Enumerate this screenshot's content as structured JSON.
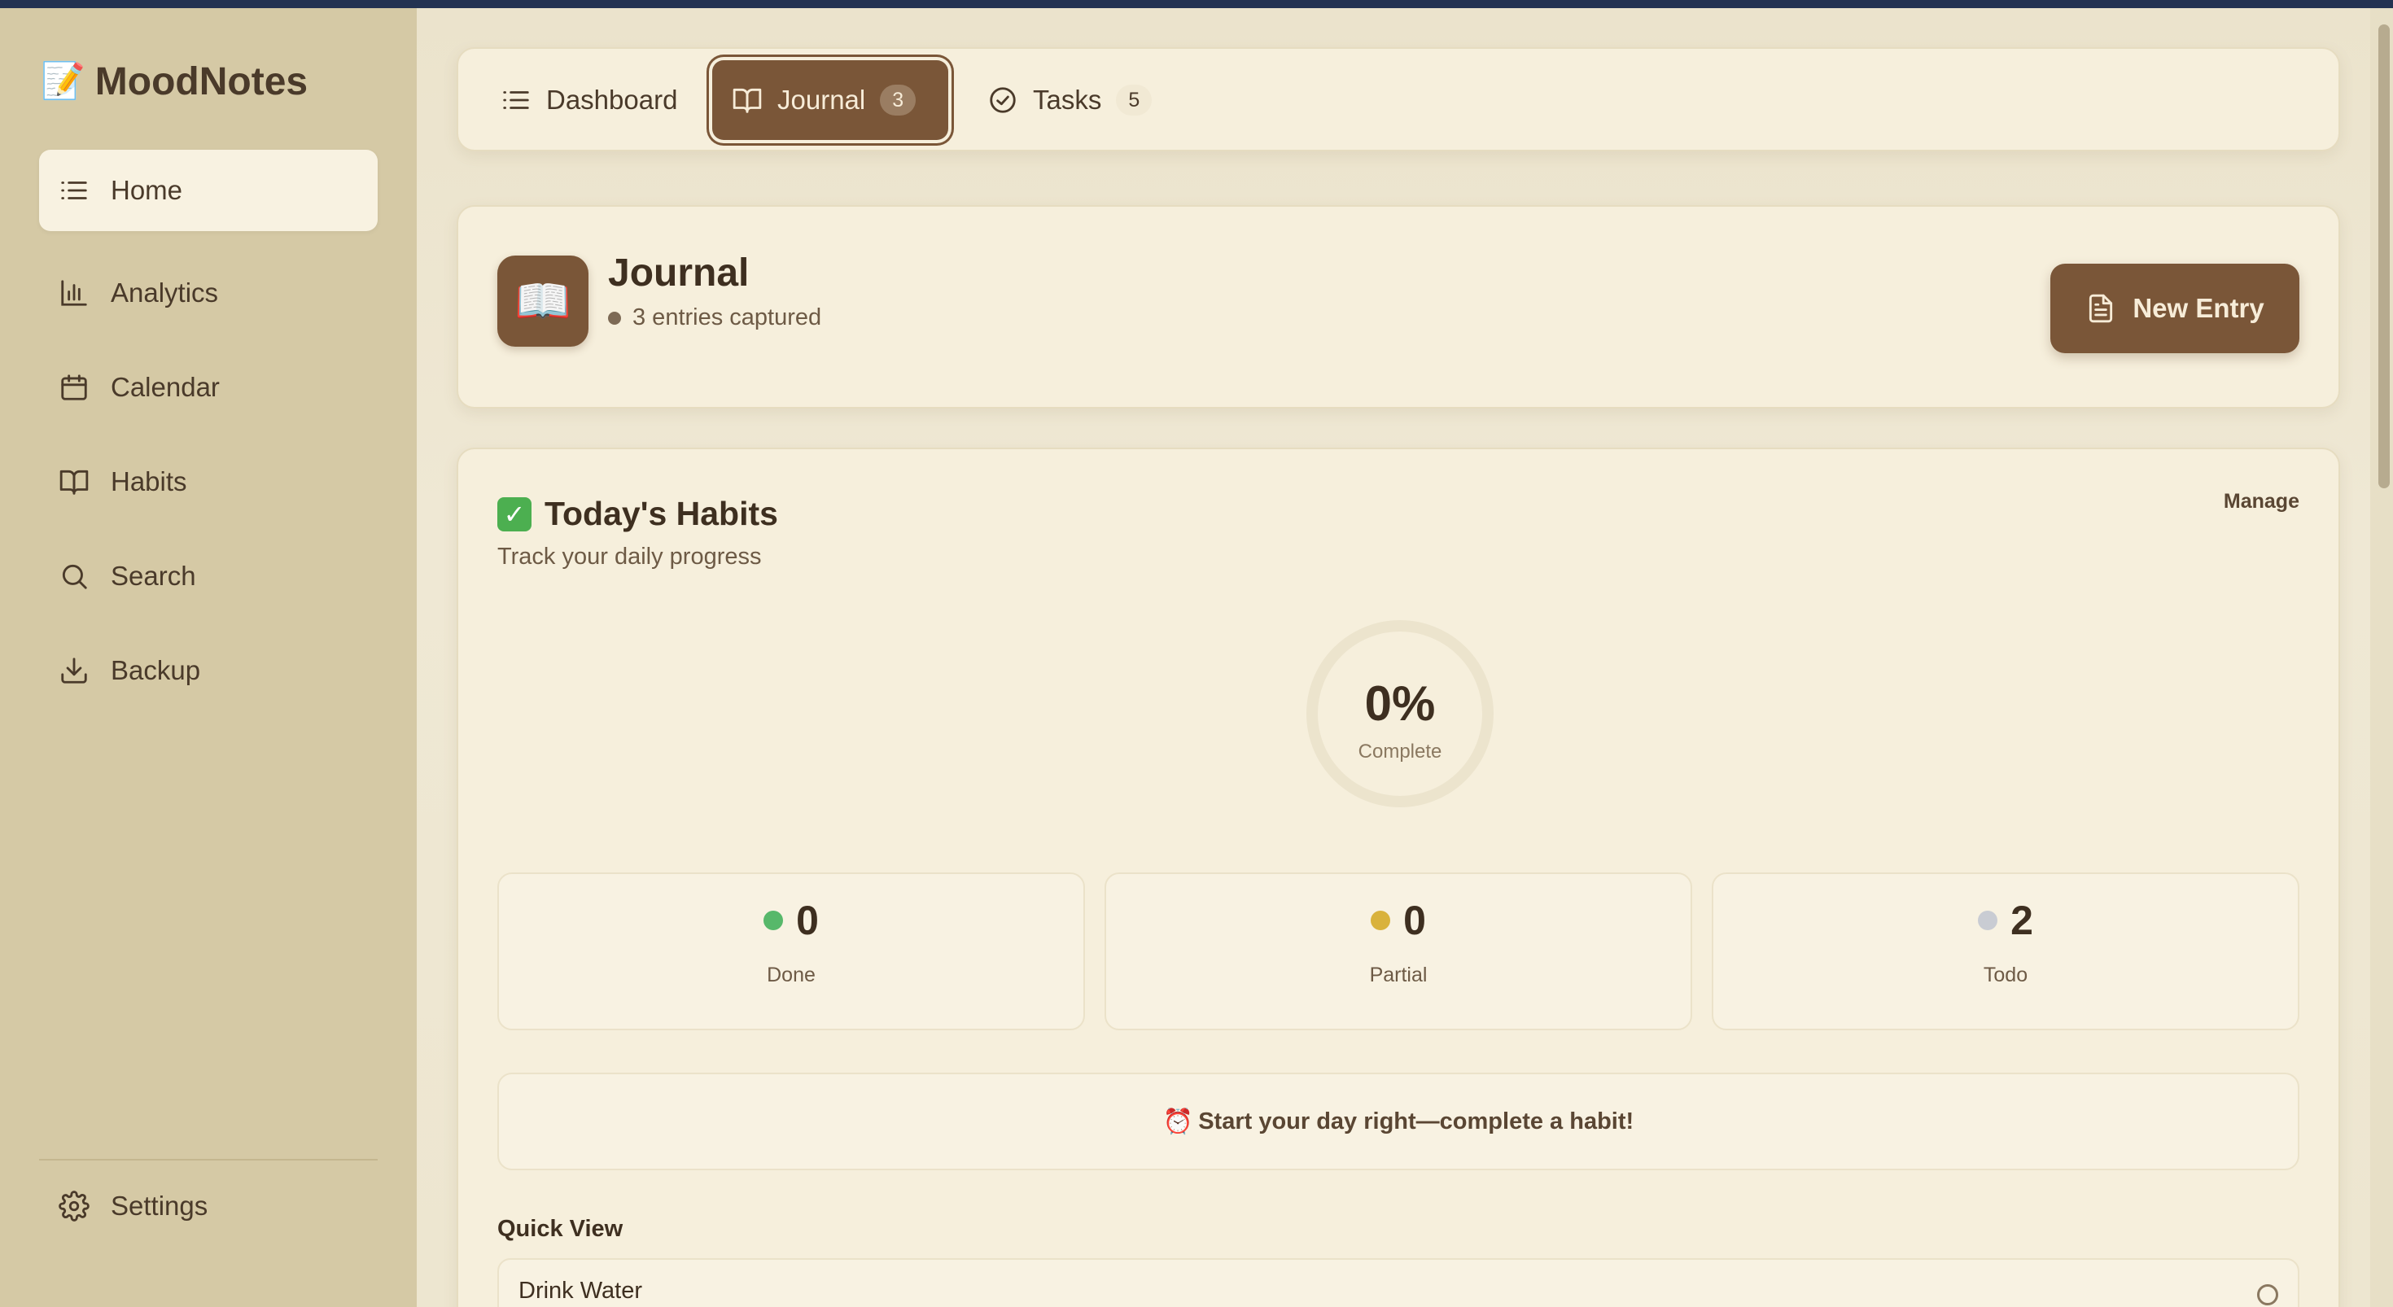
{
  "app": {
    "name": "MoodNotes",
    "icon": "memo-icon"
  },
  "sidebar": {
    "items": [
      {
        "label": "Home",
        "icon": "list-icon",
        "active": true
      },
      {
        "label": "Analytics",
        "icon": "bar-chart-icon"
      },
      {
        "label": "Calendar",
        "icon": "calendar-icon"
      },
      {
        "label": "Habits",
        "icon": "book-icon"
      },
      {
        "label": "Search",
        "icon": "search-icon"
      },
      {
        "label": "Backup",
        "icon": "download-icon"
      }
    ],
    "settings_label": "Settings"
  },
  "tabs": [
    {
      "label": "Dashboard",
      "icon": "list-icon"
    },
    {
      "label": "Journal",
      "icon": "book-icon",
      "badge": "3",
      "active": true
    },
    {
      "label": "Tasks",
      "icon": "check-circle-icon",
      "badge": "5"
    }
  ],
  "header": {
    "title": "Journal",
    "subtitle": "3 entries captured",
    "icon": "open-book-icon",
    "new_entry_label": "New Entry"
  },
  "habits": {
    "title": "Today's Habits",
    "subtitle": "Track your daily progress",
    "manage_label": "Manage",
    "progress_value": "0%",
    "progress_fraction": 0,
    "progress_label": "Complete",
    "stats": [
      {
        "value": "0",
        "label": "Done",
        "color": "#57b86a"
      },
      {
        "value": "0",
        "label": "Partial",
        "color": "#d9b23c"
      },
      {
        "value": "2",
        "label": "Todo",
        "color": "#c9ccd3"
      }
    ],
    "motivation": "Start your day right—complete a habit!",
    "quick_view_title": "Quick View",
    "quick_items": [
      {
        "label": "Drink Water",
        "done": false
      }
    ]
  },
  "colors": {
    "accent": "#7a5638",
    "sidebar_bg": "#d5c9a5",
    "card_bg": "#f6efdc",
    "topbar": "#243352"
  }
}
